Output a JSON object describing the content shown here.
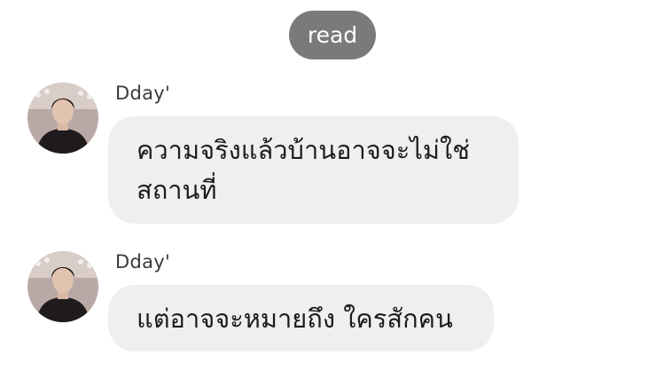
{
  "read_status": "read",
  "messages": [
    {
      "sender": "Dday'",
      "lines": [
        "ความจริงแล้วบ้านอาจจะไม่ใช่",
        "สถานที่"
      ]
    },
    {
      "sender": "Dday'",
      "lines": [
        "แต่อาจจะหมายถึง ใครสักคน"
      ]
    }
  ],
  "colors": {
    "read_pill": "#7a7a7a",
    "bubble": "#efefef",
    "background": "#ffffff"
  },
  "icons": {
    "avatar": "profile-photo"
  }
}
